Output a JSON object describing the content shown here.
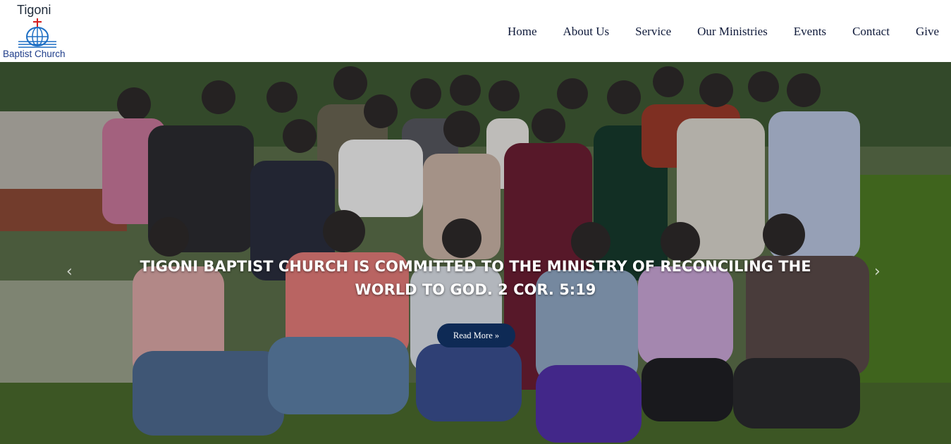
{
  "site": {
    "logo_top": "Tigoni",
    "logo_bottom": "Baptist Church",
    "logo_icon": "globe-cross-icon"
  },
  "nav": {
    "items": [
      "Home",
      "About Us",
      "Service",
      "Our Ministries",
      "Events",
      "Contact",
      "Give"
    ]
  },
  "hero": {
    "caption_line1": "TIGONI BAPTIST CHURCH IS COMMITTED TO THE MINISTRY OF RECONCILING THE",
    "caption_line2": "WORLD TO GOD. 2 COR. 5:19",
    "button_label": "Read More »",
    "prev_icon": "chevron-left-icon",
    "next_icon": "chevron-right-icon"
  },
  "colors": {
    "nav_text": "#0f1a3a",
    "button_bg": "#0e2a55",
    "logo_blue": "#1f3d8a",
    "logo_red": "#d41f1f"
  }
}
